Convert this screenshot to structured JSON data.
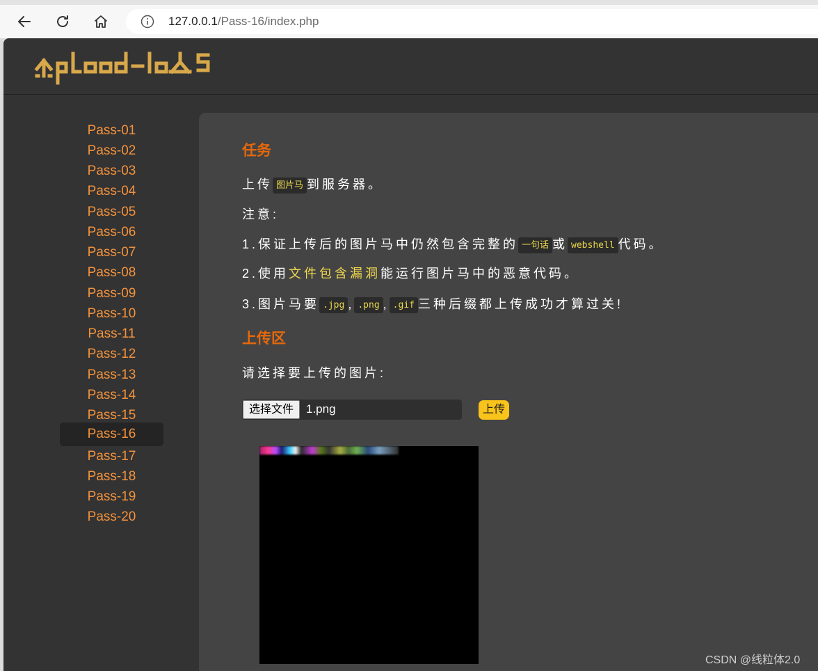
{
  "browser": {
    "url_host": "127.0.0.1",
    "url_path": "/Pass-16/index.php"
  },
  "header": {
    "logo_text": "Upload-labs"
  },
  "menu": {
    "items": [
      "Pass-01",
      "Pass-02",
      "Pass-03",
      "Pass-04",
      "Pass-05",
      "Pass-06",
      "Pass-07",
      "Pass-08",
      "Pass-09",
      "Pass-10",
      "Pass-11",
      "Pass-12",
      "Pass-13",
      "Pass-14",
      "Pass-15",
      "Pass-16",
      "Pass-17",
      "Pass-18",
      "Pass-19",
      "Pass-20"
    ],
    "active": "Pass-16"
  },
  "task": {
    "heading": "任务",
    "line1_a": "上传",
    "line1_code": "图片马",
    "line1_b": "到服务器。",
    "note": "注意:",
    "rule1_a": "1.保证上传后的图片马中仍然包含完整的",
    "rule1_code1": "一句话",
    "rule1_mid": "或",
    "rule1_code2": "webshell",
    "rule1_b": "代码。",
    "rule2_a": "2.使用",
    "rule2_hl": "文件包含漏洞",
    "rule2_b": "能运行图片马中的恶意代码。",
    "rule3_a": "3.图片马要",
    "rule3_code1": ".jpg",
    "rule3_sep1": ",",
    "rule3_code2": ".png",
    "rule3_sep2": ",",
    "rule3_code3": ".gif",
    "rule3_b": "三种后缀都上传成功才算过关!"
  },
  "upload": {
    "heading": "上传区",
    "prompt": "请选择要上传的图片:",
    "choose_label": "选择文件",
    "filename": "1.png",
    "submit_label": "上传"
  },
  "watermark": "CSDN @线粒体2.0",
  "colors": {
    "accent_orange": "#e8680a",
    "menu_text": "#f3923c",
    "button_yellow": "#f8c31a",
    "logo_gold": "#d8a84a"
  }
}
